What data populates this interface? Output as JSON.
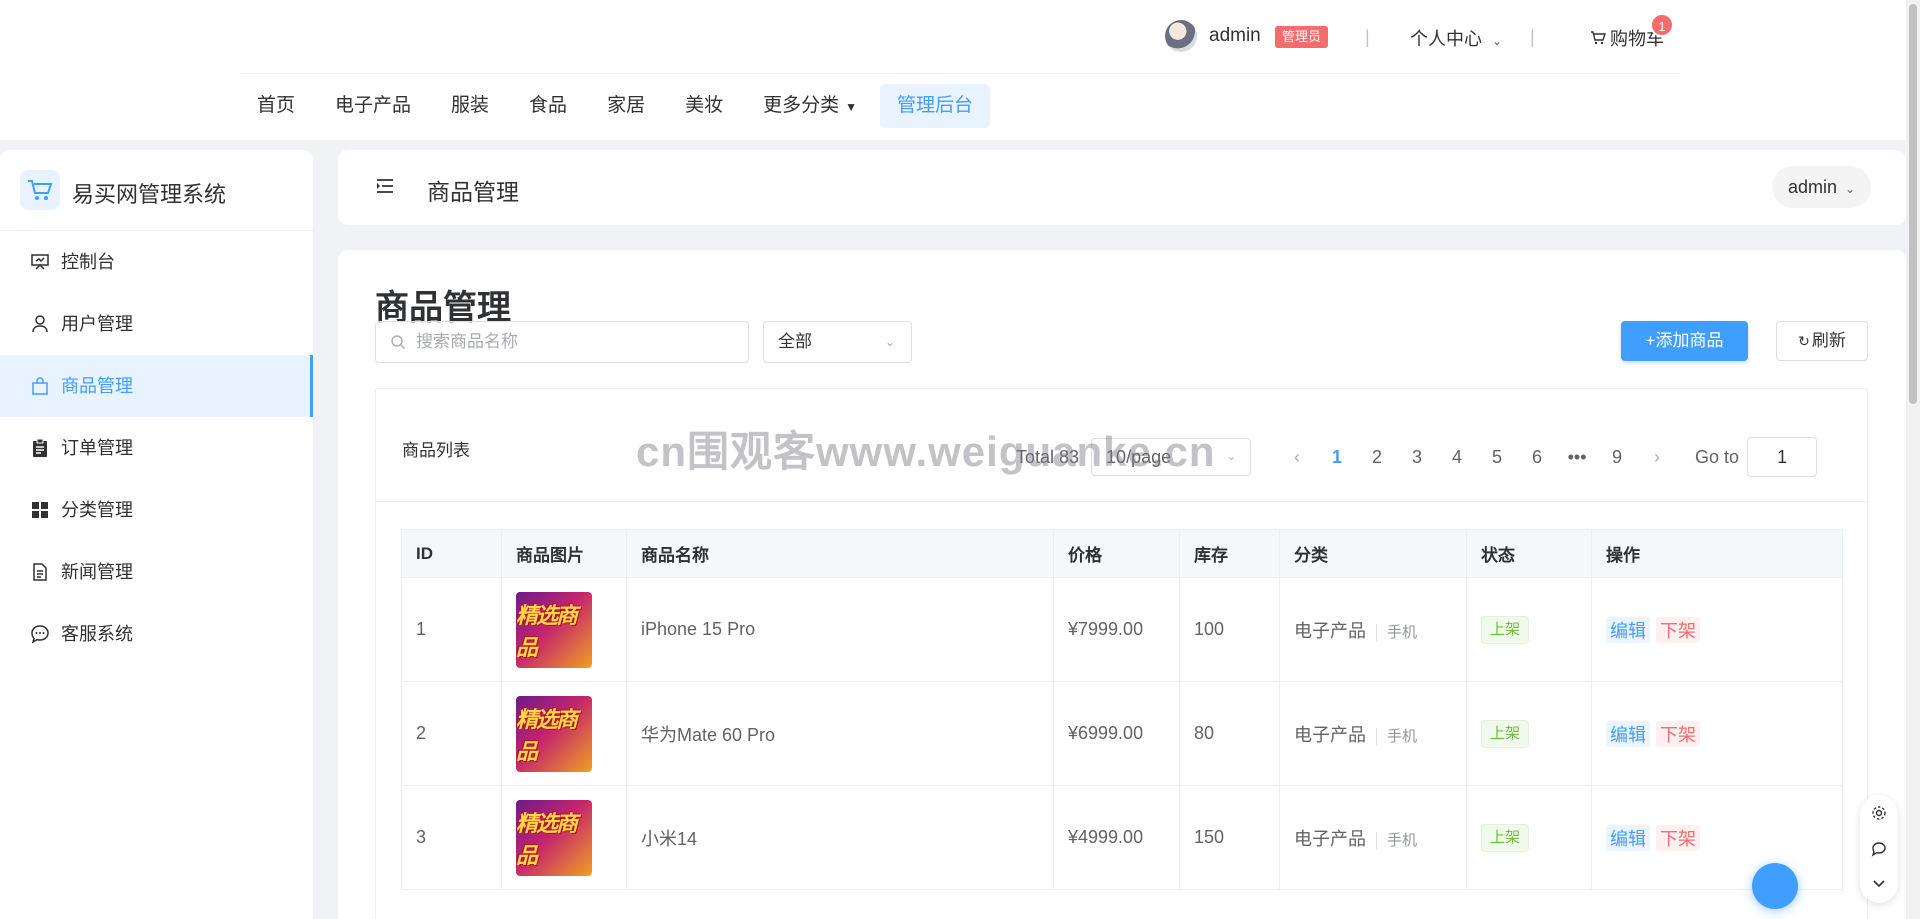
{
  "topbar": {
    "username": "admin",
    "role_badge": "管理员",
    "personal_center": "个人中心",
    "cart_label": "购物车",
    "cart_count": "1"
  },
  "nav": {
    "items": [
      "首页",
      "电子产品",
      "服装",
      "食品",
      "家居",
      "美妆",
      "更多分类",
      "管理后台"
    ],
    "active_index": 7
  },
  "sidebar": {
    "title": "易买网管理系统",
    "items": [
      {
        "label": "控制台",
        "icon": "presentation-icon"
      },
      {
        "label": "用户管理",
        "icon": "user-icon"
      },
      {
        "label": "商品管理",
        "icon": "shopping-bag-icon"
      },
      {
        "label": "订单管理",
        "icon": "clipboard-icon"
      },
      {
        "label": "分类管理",
        "icon": "grid-icon"
      },
      {
        "label": "新闻管理",
        "icon": "document-icon"
      },
      {
        "label": "客服系统",
        "icon": "chat-icon"
      }
    ],
    "active_index": 2
  },
  "header": {
    "title": "商品管理",
    "user": "admin"
  },
  "main": {
    "title": "商品管理",
    "search_placeholder": "搜索商品名称",
    "filter_value": "全部",
    "add_button": "+添加商品",
    "refresh_button": "刷新",
    "list_title": "商品列表"
  },
  "pagination": {
    "total_label": "Total 83",
    "page_size": "10/page",
    "pages": [
      "1",
      "2",
      "3",
      "4",
      "5",
      "6",
      "•••",
      "9"
    ],
    "current_page": "1",
    "goto_label": "Go to",
    "goto_value": "1"
  },
  "table": {
    "columns": [
      "ID",
      "商品图片",
      "商品名称",
      "价格",
      "库存",
      "分类",
      "状态",
      "操作"
    ],
    "thumb_text": "精选商品",
    "rows": [
      {
        "id": "1",
        "name": "iPhone 15 Pro",
        "price": "¥7999.00",
        "stock": "100",
        "category": "电子产品",
        "subcategory": "手机",
        "status": "上架",
        "edit": "编辑",
        "off": "下架"
      },
      {
        "id": "2",
        "name": "华为Mate 60 Pro",
        "price": "¥6999.00",
        "stock": "80",
        "category": "电子产品",
        "subcategory": "手机",
        "status": "上架",
        "edit": "编辑",
        "off": "下架"
      },
      {
        "id": "3",
        "name": "小米14",
        "price": "¥4999.00",
        "stock": "150",
        "category": "电子产品",
        "subcategory": "手机",
        "status": "上架",
        "edit": "编辑",
        "off": "下架"
      }
    ]
  },
  "watermark": "cn围观客www.weiguanke.cn",
  "colors": {
    "primary": "#409eff",
    "danger": "#f56c6c",
    "success": "#67c23a",
    "active_bg": "#e8f3ff"
  }
}
